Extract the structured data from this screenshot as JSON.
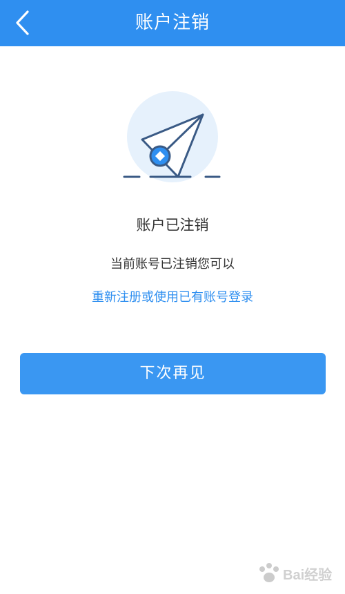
{
  "header": {
    "title": "账户注销",
    "back_icon": "chevron-left-icon",
    "background": "#2f8ff0"
  },
  "illustration": {
    "icon": "paper-plane-icon",
    "circle_color": "#e6f1fc",
    "stroke_color": "#3a5a85",
    "accent_color": "#2f8ff0"
  },
  "status": {
    "title": "账户已注销",
    "description": "当前账号已注销您可以",
    "link": "重新注册或使用已有账号登录"
  },
  "actions": {
    "primary_label": "下次再见",
    "primary_color": "#3a97f2"
  },
  "watermark": {
    "icon": "baidu-jingyan-logo",
    "text": "Bai经验"
  }
}
